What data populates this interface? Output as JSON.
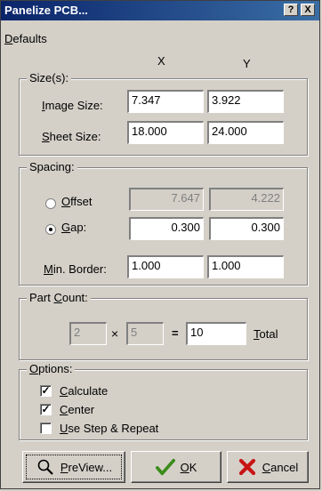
{
  "window": {
    "title": "Panelize PCB...",
    "help_label": "?",
    "close_label": "X"
  },
  "menu": {
    "defaults": "Defaults",
    "defaults_accel": "D",
    "defaults_rest": "efaults"
  },
  "columns": {
    "x": "X",
    "y": "Y"
  },
  "sizes": {
    "legend": "Size(s):",
    "image_label_accel": "I",
    "image_label_rest": "mage Size:",
    "image_x": "7.347",
    "image_y": "3.922",
    "sheet_label_accel": "S",
    "sheet_label_rest": "heet Size:",
    "sheet_x": "18.000",
    "sheet_y": "24.000"
  },
  "spacing": {
    "legend": "Spacing:",
    "offset_accel": "O",
    "offset_rest": "ffset",
    "offset_selected": false,
    "offset_x": "7.647",
    "offset_y": "4.222",
    "gap_accel": "G",
    "gap_rest": "ap:",
    "gap_selected": true,
    "gap_x": "0.300",
    "gap_y": "0.300",
    "border_accel": "M",
    "border_rest": "in. Border:",
    "border_x": "1.000",
    "border_y": "1.000"
  },
  "part_count": {
    "legend_pre": "Part ",
    "legend_accel": "C",
    "legend_rest": "ount:",
    "cols": "2",
    "times": "×",
    "rows": "5",
    "equals": "=",
    "total": "10",
    "total_accel": "T",
    "total_rest": "otal"
  },
  "options": {
    "legend_accel": "O",
    "legend_rest": "ptions:",
    "calculate_accel": "C",
    "calculate_rest": "alculate",
    "calculate_checked": true,
    "center_accel": "C",
    "center_rest": "enter",
    "center_checked": true,
    "step_accel": "U",
    "step_rest": "se Step & Repeat",
    "step_checked": false
  },
  "buttons": {
    "preview_accel": "P",
    "preview_rest": "reView...",
    "ok_accel": "O",
    "ok_rest": "K",
    "cancel_accel": "C",
    "cancel_rest": "ancel"
  },
  "colors": {
    "dialog_bg": "#d4d0c8",
    "titlebar_start": "#0a246a",
    "titlebar_end": "#3a6ea5",
    "ok_check": "#3a8c1a",
    "cancel_x": "#c81414"
  }
}
